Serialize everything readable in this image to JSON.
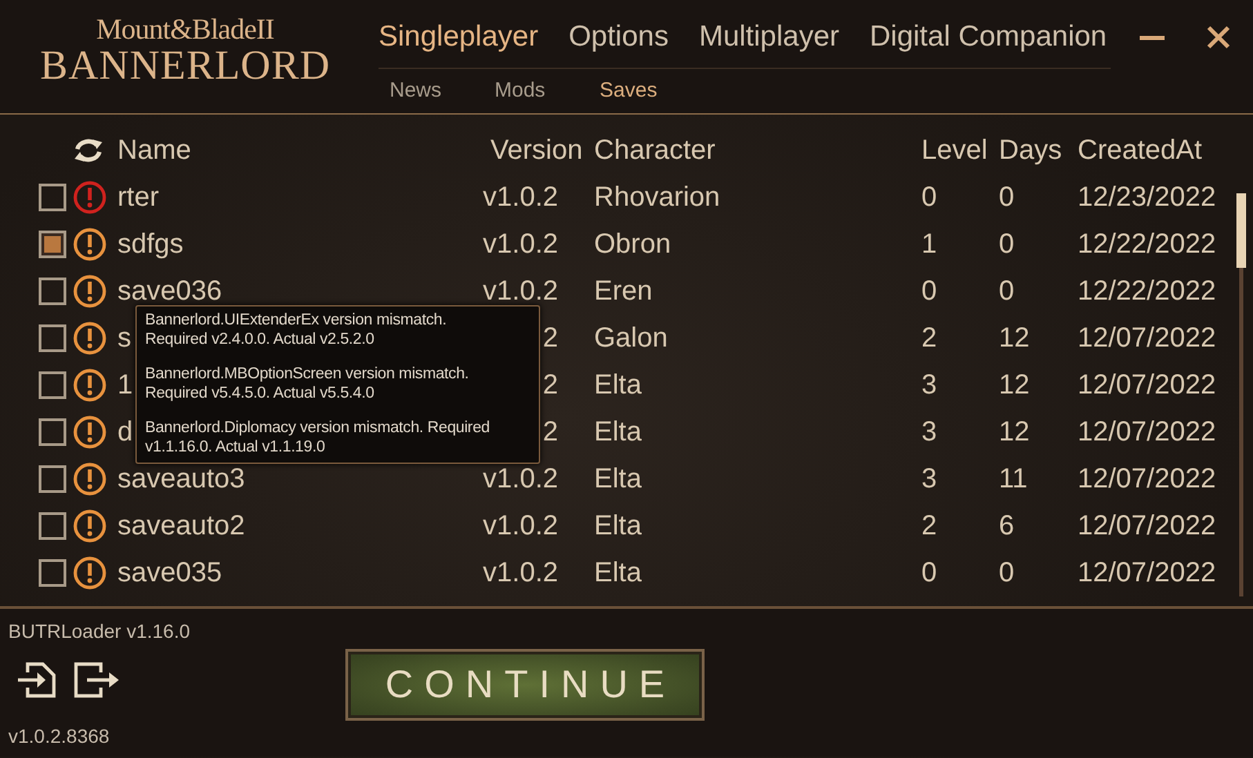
{
  "logo": {
    "line_1": "Mount&BladeII",
    "line_2": "BANNERLORD"
  },
  "tabs": [
    {
      "label": "Singleplayer",
      "selected": true
    },
    {
      "label": "Options",
      "selected": false
    },
    {
      "label": "Multiplayer",
      "selected": false
    },
    {
      "label": "Digital Companion",
      "selected": false
    }
  ],
  "subtabs": [
    {
      "label": "News",
      "selected": false
    },
    {
      "label": "Mods",
      "selected": false
    },
    {
      "label": "Saves",
      "selected": true
    }
  ],
  "table": {
    "columns": [
      "Name",
      "Version",
      "Character",
      "Level",
      "Days",
      "CreatedAt"
    ],
    "rows": [
      {
        "checked": false,
        "error": true,
        "name": "rter",
        "version": "v1.0.2",
        "character": "Rhovarion",
        "character_level": "0",
        "days": "0",
        "created": "12/23/2022"
      },
      {
        "checked": true,
        "error": false,
        "name": "sdfgs",
        "version": "v1.0.2",
        "character": "Obron",
        "character_level": "1",
        "days": "0",
        "created": "12/22/2022"
      },
      {
        "checked": false,
        "error": false,
        "name": "save036",
        "version": "v1.0.2",
        "character": "Eren",
        "character_level": "0",
        "days": "0",
        "created": "12/22/2022"
      },
      {
        "checked": false,
        "error": false,
        "name": "s",
        "version": "2",
        "character": "Galon",
        "character_level": "2",
        "days": "12",
        "created": "12/07/2022"
      },
      {
        "checked": false,
        "error": false,
        "name": "1",
        "version": "2",
        "character": "Elta",
        "character_level": "3",
        "days": "12",
        "created": "12/07/2022"
      },
      {
        "checked": false,
        "error": false,
        "name": "d",
        "version": "2",
        "character": "Elta",
        "character_level": "3",
        "days": "12",
        "created": "12/07/2022"
      },
      {
        "checked": false,
        "error": false,
        "name": "saveauto3",
        "version": "v1.0.2",
        "character": "Elta",
        "character_level": "3",
        "days": "11",
        "created": "12/07/2022"
      },
      {
        "checked": false,
        "error": false,
        "name": "saveauto2",
        "version": "v1.0.2",
        "character": "Elta",
        "character_level": "2",
        "days": "6",
        "created": "12/07/2022"
      },
      {
        "checked": false,
        "error": false,
        "name": "save035",
        "version": "v1.0.2",
        "character": "Elta",
        "character_level": "0",
        "days": "0",
        "created": "12/07/2022"
      }
    ]
  },
  "tooltip": {
    "messages": [
      "Bannerlord.UIExtenderEx version mismatch. Required v2.4.0.0. Actual v2.5.2.0",
      "Bannerlord.MBOptionScreen version mismatch. Required v5.4.5.0. Actual v5.5.4.0",
      "Bannerlord.Diplomacy version mismatch. Required v1.1.16.0. Actual v1.1.19.0"
    ]
  },
  "footer": {
    "loader_version": "BUTRLoader v1.16.0",
    "game_version": "v1.0.2.8368",
    "continue_button": "CONTINUE"
  }
}
